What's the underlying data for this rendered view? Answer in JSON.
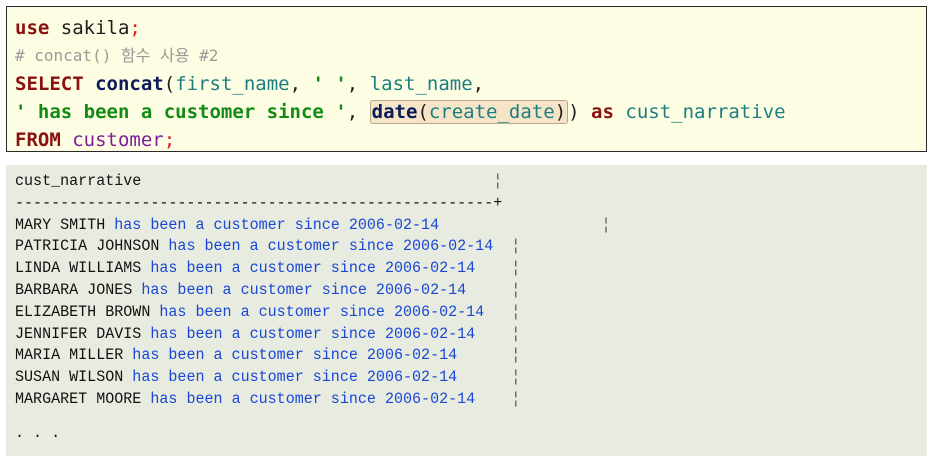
{
  "query": {
    "use_kw": "use",
    "db_name": " sakila",
    "semi": ";",
    "comment": "# concat() 함수 사용 #2",
    "select_kw": "SELECT",
    "sp": " ",
    "concat_fn": "concat",
    "concat_open": "(",
    "first_name": "first_name",
    "comma_sp": ", ",
    "space_str": "' '",
    "last_name": "last_name",
    "comma": ",",
    "phrase_str": "' has been a customer since '",
    "date_fn": "date",
    "paren_open": "(",
    "create_date": "create_date",
    "paren_close": ")",
    "concat_close": ")",
    "as_kw": "as",
    "alias": "cust_narrative",
    "from_kw": "FROM",
    "table": "customer",
    "end_semi": ";"
  },
  "result": {
    "header": "cust_narrative",
    "header_bar": "¦",
    "divider": "-----------------------------------------------------+",
    "phrase": "has been a customer since",
    "rows": [
      {
        "name": "MARY SMITH",
        "date": "2006-02-14",
        "pad": "                  ¦"
      },
      {
        "name": "PATRICIA JOHNSON",
        "date": "2006-02-14",
        "pad": "  ¦"
      },
      {
        "name": "LINDA WILLIAMS",
        "date": "2006-02-14",
        "pad": "    ¦"
      },
      {
        "name": "BARBARA JONES",
        "date": "2006-02-14",
        "pad": "     ¦"
      },
      {
        "name": "ELIZABETH BROWN",
        "date": "2006-02-14",
        "pad": "   ¦"
      },
      {
        "name": "JENNIFER DAVIS",
        "date": "2006-02-14",
        "pad": "    ¦"
      },
      {
        "name": "MARIA MILLER",
        "date": "2006-02-14",
        "pad": "      ¦"
      },
      {
        "name": "SUSAN WILSON",
        "date": "2006-02-14",
        "pad": "      ¦"
      },
      {
        "name": "MARGARET MOORE",
        "date": "2006-02-14",
        "pad": "    ¦"
      }
    ],
    "ellipsis": ". . ."
  },
  "colors": {
    "code_bg": "#fdfde3",
    "result_bg": "#e8ece0",
    "keyword": "#8b1010",
    "function": "#0c1a5a",
    "identifier": "#1b7f80",
    "string": "#138a13",
    "table": "#7d1f9c",
    "result_phrase": "#1a47d6"
  }
}
